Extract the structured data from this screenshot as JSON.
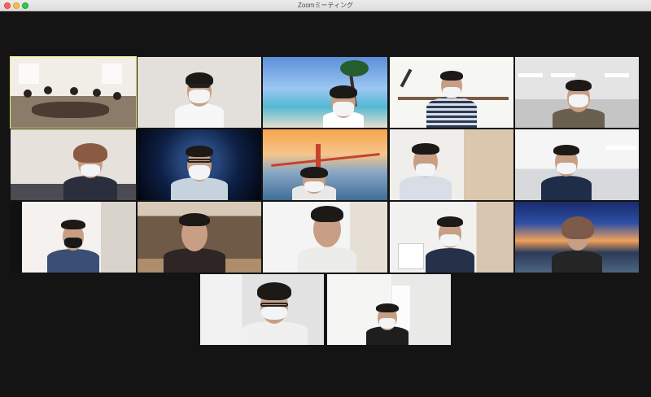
{
  "window": {
    "title": "Zoomミーティング"
  },
  "gallery": {
    "view": "gallery",
    "participant_count": 17,
    "active_speaker_index": 0,
    "colors": {
      "active_border": "#e8e56a",
      "background": "#141414"
    }
  }
}
